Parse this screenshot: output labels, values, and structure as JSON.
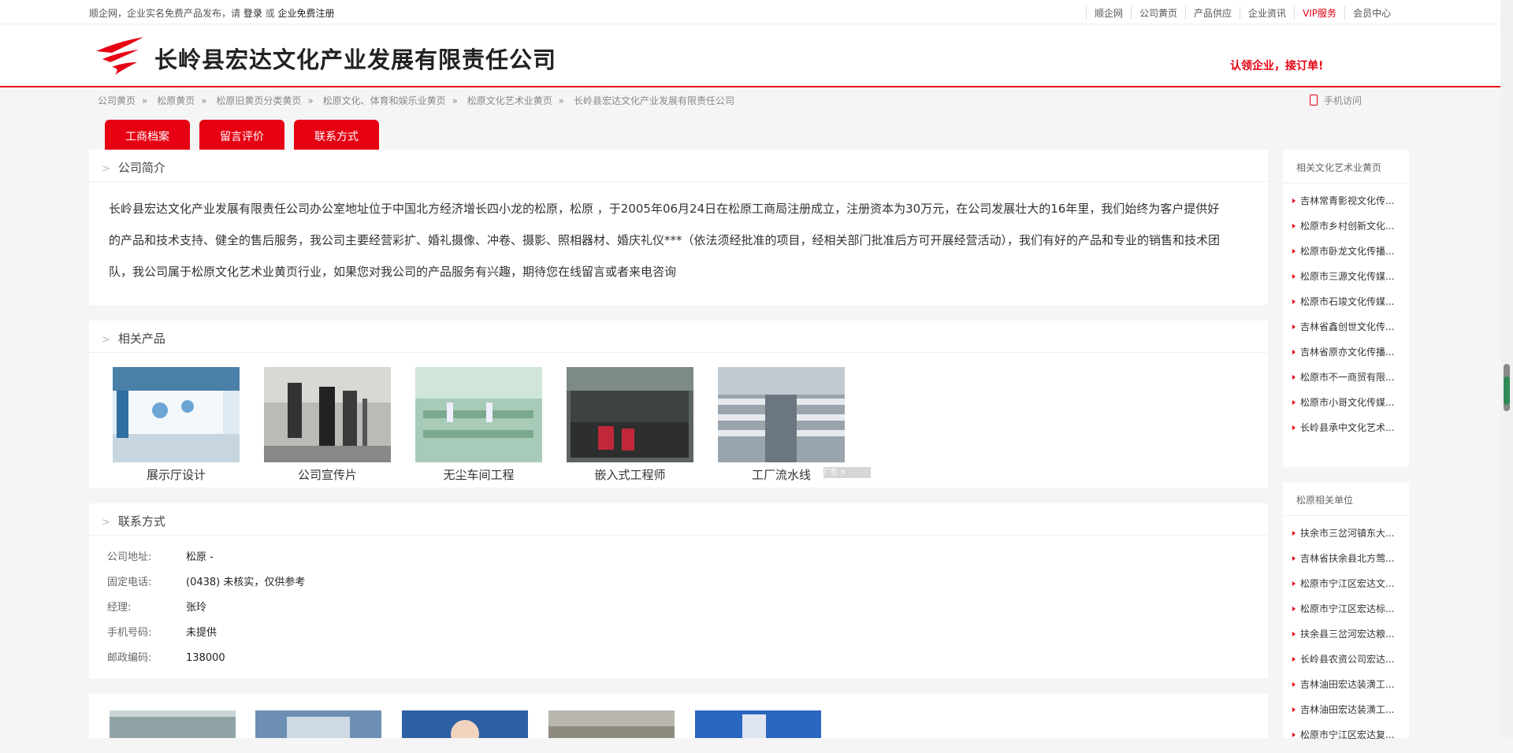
{
  "topbar": {
    "intro": "顺企网，企业实名免费产品发布，请",
    "login": "登录",
    "or": "或",
    "register": "企业免费注册",
    "links": [
      "顺企网",
      "公司黄页",
      "产品供应",
      "企业资讯",
      "VIP服务",
      "会员中心"
    ]
  },
  "header": {
    "company_name": "长岭县宏达文化产业发展有限责任公司",
    "claim": "认领企业，接订单!"
  },
  "breadcrumb": [
    "公司黄页",
    "松原黄页",
    "松原旧黄页分类黄页",
    "松原文化、体育和娱乐业黄页",
    "松原文化艺术业黄页",
    "长岭县宏达文化产业发展有限责任公司"
  ],
  "mobile": "手机访问",
  "tabs": [
    "工商档案",
    "留言评价",
    "联系方式"
  ],
  "intro": {
    "title": "公司简介",
    "text": "长岭县宏达文化产业发展有限责任公司办公室地址位于中国北方经济增长四小龙的松原，松原 ，于2005年06月24日在松原工商局注册成立，注册资本为30万元，在公司发展壮大的16年里，我们始终为客户提供好的产品和技术支持、健全的售后服务，我公司主要经营彩扩、婚礼摄像、冲卷、摄影、照相器材、婚庆礼仪***（依法须经批准的项目，经相关部门批准后方可开展经营活动），我们有好的产品和专业的销售和技术团队，我公司属于松原文化艺术业黄页行业，如果您对我公司的产品服务有兴趣，期待您在线留言或者来电咨询"
  },
  "products": {
    "title": "相关产品",
    "items": [
      "展示厅设计",
      "公司宣传片",
      "无尘车间工程",
      "嵌入式工程师",
      "工厂流水线"
    ],
    "ad_label": "广告"
  },
  "contact": {
    "title": "联系方式",
    "rows": [
      {
        "label": "公司地址:",
        "value": "松原 -"
      },
      {
        "label": "固定电话:",
        "value": "(0438) 未核实，仅供参考"
      },
      {
        "label": "经理:",
        "value": "张玲"
      },
      {
        "label": "手机号码:",
        "value": "未提供"
      },
      {
        "label": "邮政编码:",
        "value": "138000"
      }
    ]
  },
  "sidebar": {
    "related_title": "相关文化艺术业黄页",
    "related": [
      "吉林常青影视文化传...",
      "松原市乡村创新文化...",
      "松原市卧龙文化传播...",
      "松原市三源文化传媒...",
      "松原市石竣文化传媒...",
      "吉林省鑫创世文化传...",
      "吉林省原亦文化传播...",
      "松原市不一商贸有限...",
      "松原市小哥文化传媒...",
      "长岭县承中文化艺术..."
    ],
    "units_title": "松原相关单位",
    "units": [
      "扶余市三岔河镇东大...",
      "吉林省扶余县北方莺...",
      "松原市宁江区宏达文...",
      "松原市宁江区宏达标...",
      "扶余县三岔河宏达粮...",
      "长岭县农资公司宏达...",
      "吉林油田宏达装潢工...",
      "吉林油田宏达装潢工...",
      "松原市宁江区宏达复..."
    ]
  },
  "colors": {
    "accent": "#e60012"
  }
}
